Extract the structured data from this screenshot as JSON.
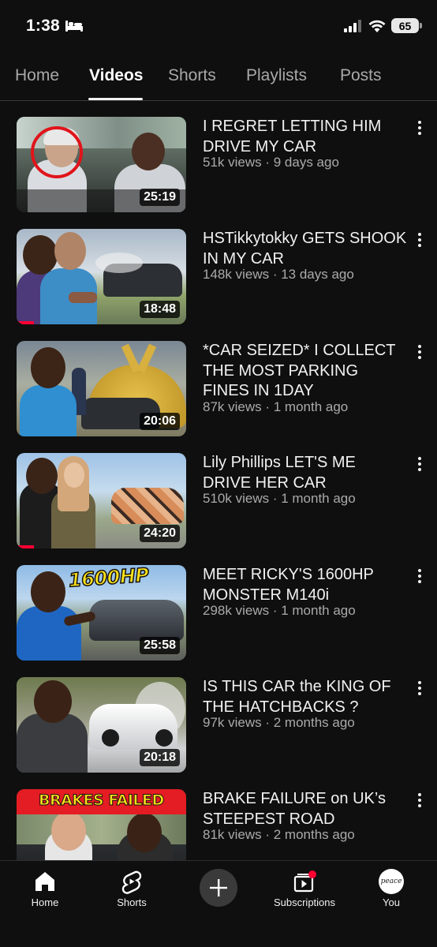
{
  "status_bar": {
    "time": "1:38",
    "battery": "65",
    "icons": [
      "bed-icon",
      "signal-icon",
      "wifi-icon",
      "battery-icon"
    ]
  },
  "tabs": [
    {
      "label": "Home",
      "active": false
    },
    {
      "label": "Videos",
      "active": true
    },
    {
      "label": "Shorts",
      "active": false
    },
    {
      "label": "Playlists",
      "active": false
    },
    {
      "label": "Posts",
      "active": false
    }
  ],
  "videos": [
    {
      "title": "I REGRET LETTING HIM DRIVE MY CAR",
      "meta": "51k views · 9 days ago",
      "duration": "25:19",
      "watched_fraction": 0
    },
    {
      "title": "HSTikkytokky GETS SHOOK IN MY CAR",
      "meta": "148k views · 13 days ago",
      "duration": "18:48",
      "watched_fraction": 0.1
    },
    {
      "title": "*CAR SEIZED* I COLLECT THE MOST PARKING FINES IN 1DAY",
      "meta": "87k views · 1 month ago",
      "duration": "20:06",
      "watched_fraction": 0
    },
    {
      "title": "Lily Phillips LET'S ME DRIVE HER CAR",
      "meta": "510k views · 1 month ago",
      "duration": "24:20",
      "watched_fraction": 0.1
    },
    {
      "title": "MEET RICKY'S 1600HP MONSTER M140i",
      "meta": "298k views · 1 month ago",
      "duration": "25:58",
      "watched_fraction": 0,
      "thumb_text": "1600HP"
    },
    {
      "title": "IS THIS CAR the KING OF THE HATCHBACKS ?",
      "meta": "97k views · 2 months ago",
      "duration": "20:18",
      "watched_fraction": 0
    },
    {
      "title": "BRAKE FAILURE on UK’s STEEPEST ROAD",
      "meta": "81k views · 2 months ago",
      "duration": "",
      "watched_fraction": 0,
      "thumb_text": "BRAKES FAILED"
    }
  ],
  "bottom_nav": {
    "home": "Home",
    "shorts": "Shorts",
    "subscriptions": "Subscriptions",
    "you": "You",
    "avatar_text": "peace"
  },
  "colors": {
    "background": "#0f0f0f",
    "accent": "#ff0033",
    "secondary_text": "#aaaaaa"
  }
}
